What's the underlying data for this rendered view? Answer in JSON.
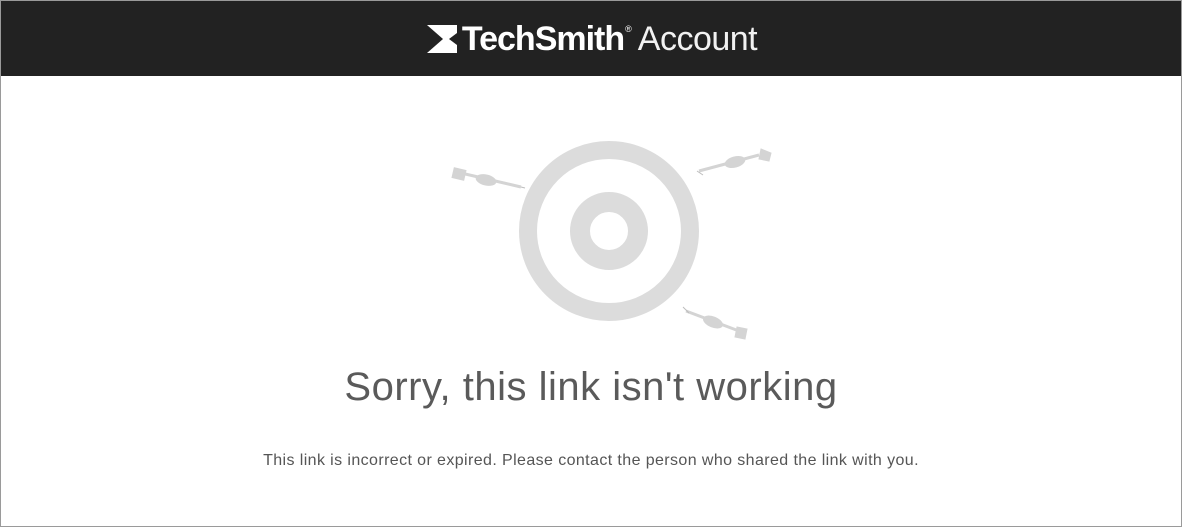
{
  "header": {
    "brand_name": "TechSmith",
    "registered_mark": "®",
    "product_name": "Account",
    "logo_icon": "techsmith-logo-icon",
    "background_color": "#222222"
  },
  "main": {
    "illustration_icon": "target-with-darts-icon",
    "illustration_color": "#d9d9d9",
    "headline": "Sorry, this link isn't working",
    "message": "This link is incorrect or expired. Please contact the person who shared the link with you."
  }
}
